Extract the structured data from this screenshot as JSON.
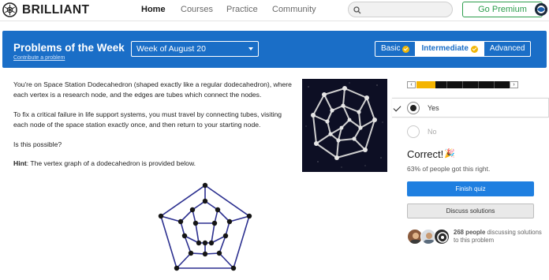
{
  "nav": {
    "brand": "BRILLIANT",
    "links": [
      "Home",
      "Courses",
      "Practice",
      "Community"
    ],
    "active_link": "Home",
    "search_placeholder": "",
    "premium_label": "Go Premium"
  },
  "header": {
    "title": "Problems of the Week",
    "subtitle_link": "Contribute a problem",
    "week_selected": "Week of August 20",
    "levels": [
      "Basic",
      "Intermediate",
      "Advanced"
    ],
    "selected_level": "Intermediate",
    "completed_levels": [
      "Basic",
      "Intermediate"
    ]
  },
  "problem": {
    "paragraphs": [
      "You're on Space Station Dodecahedron (shaped exactly like a regular dodecahedron), where each vertex is a research node, and the edges are tubes which connect the nodes.",
      "To fix a critical failure in life support systems, you must travel by connecting tubes, visiting each node of the space station exactly once, and then return to your starting node.",
      "Is this possible?"
    ],
    "hint_label": "Hint",
    "hint_text": ": The vertex graph of a dodecahedron is provided below."
  },
  "progress": {
    "fill_fraction": 0.2
  },
  "answers": {
    "choices": [
      "Yes",
      "No"
    ],
    "selected": "Yes"
  },
  "result": {
    "status": "Correct!",
    "percent_text": "63% of people got this right.",
    "finish_label": "Finish quiz",
    "solutions_label": "Discuss solutions",
    "discussing_count": "268 people",
    "discussing_text": " discussing solutions to this problem"
  },
  "colors": {
    "accent_blue": "#1a6ec7",
    "button_blue": "#1f7fe0",
    "premium_green": "#2c9d4c",
    "badge_yellow": "#f2b705",
    "graph_edge": "#2b2f8f"
  }
}
